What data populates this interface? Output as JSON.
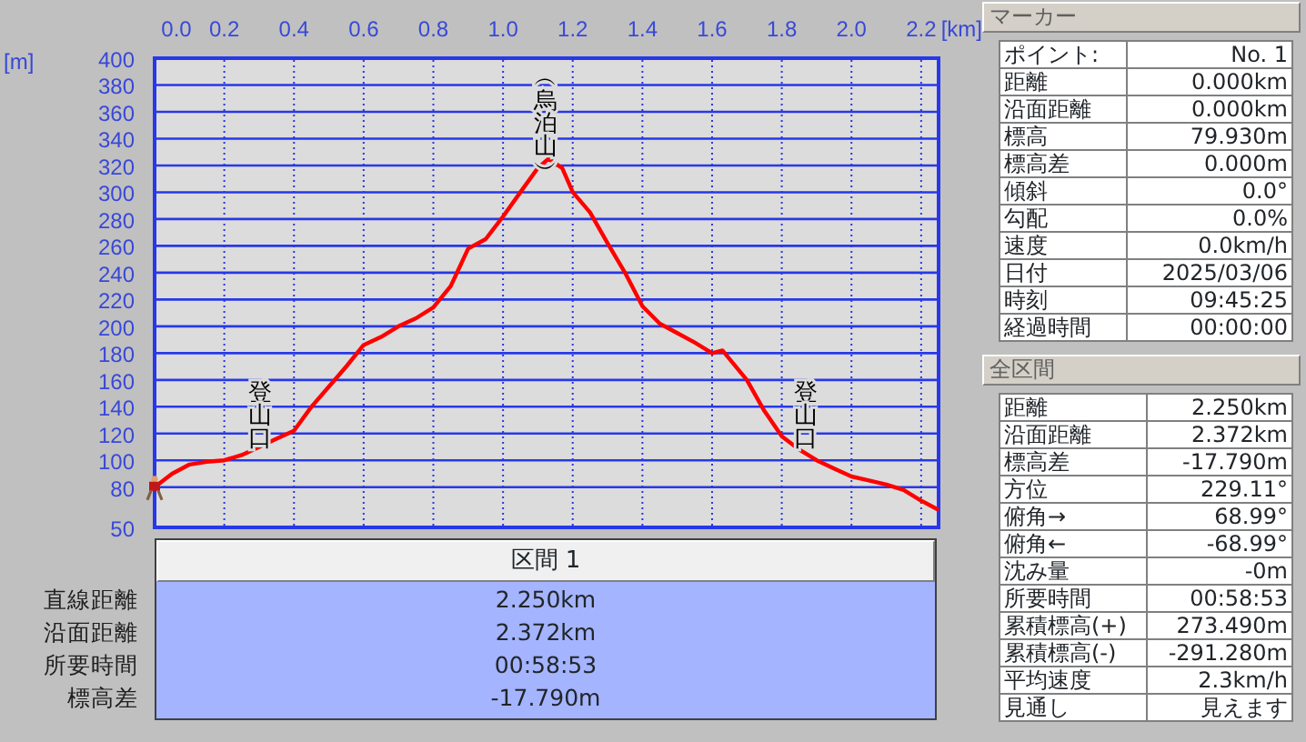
{
  "profile_chart": {
    "chart_data": {
      "type": "line",
      "xlabel": "[km]",
      "ylabel": "[m]",
      "xlim": [
        0,
        2.25
      ],
      "ylim": [
        50,
        400
      ],
      "xticks": [
        {
          "value": 0,
          "label": "0.0"
        },
        {
          "value": 0.2,
          "label": "0.2"
        },
        {
          "value": 0.4,
          "label": "0.4"
        },
        {
          "value": 0.6,
          "label": "0.6"
        },
        {
          "value": 0.8,
          "label": "0.8"
        },
        {
          "value": 1.0,
          "label": "1.0"
        },
        {
          "value": 1.2,
          "label": "1.2"
        },
        {
          "value": 1.4,
          "label": "1.4"
        },
        {
          "value": 1.6,
          "label": "1.6"
        },
        {
          "value": 1.8,
          "label": "1.8"
        },
        {
          "value": 2.0,
          "label": "2.0"
        },
        {
          "value": 2.2,
          "label": "2.2"
        }
      ],
      "yticks": [
        50,
        80,
        100,
        120,
        140,
        160,
        180,
        200,
        220,
        240,
        260,
        280,
        300,
        320,
        340,
        360,
        380,
        400
      ],
      "x": [
        0,
        0.05,
        0.1,
        0.15,
        0.2,
        0.25,
        0.3,
        0.35,
        0.4,
        0.45,
        0.5,
        0.55,
        0.6,
        0.65,
        0.7,
        0.75,
        0.8,
        0.85,
        0.9,
        0.95,
        1.0,
        1.05,
        1.1,
        1.13,
        1.17,
        1.2,
        1.25,
        1.3,
        1.35,
        1.4,
        1.45,
        1.5,
        1.55,
        1.6,
        1.63,
        1.7,
        1.75,
        1.8,
        1.85,
        1.9,
        1.95,
        2.0,
        2.05,
        2.1,
        2.15,
        2.2,
        2.25
      ],
      "grid": true,
      "series": [
        {
          "color": "#ff0000",
          "values": [
            80,
            90,
            97,
            99,
            100,
            104,
            110,
            116,
            122,
            140,
            155,
            170,
            186,
            192,
            200,
            206,
            214,
            230,
            258,
            265,
            282,
            300,
            318,
            325,
            318,
            300,
            285,
            262,
            240,
            215,
            202,
            195,
            188,
            180,
            182,
            160,
            137,
            118,
            108,
            100,
            94,
            88,
            85,
            82,
            78,
            70,
            63
          ]
        }
      ],
      "annotations": [
        "︵烏泊山︶",
        "登山口",
        "登山口"
      ]
    }
  },
  "section_table": {
    "header": "区間 1",
    "rows": [
      {
        "label": "直線距離",
        "value": "2.250km"
      },
      {
        "label": "沿面距離",
        "value": "2.372km"
      },
      {
        "label": "所要時間",
        "value": "00:58:53"
      },
      {
        "label": "標高差",
        "value": "-17.790m"
      }
    ]
  },
  "marker_panel": {
    "title": "マーカー",
    "rows": [
      {
        "label": "ポイント:",
        "value": "No. 1"
      },
      {
        "label": "距離",
        "value": "0.000km"
      },
      {
        "label": "沿面距離",
        "value": "0.000km"
      },
      {
        "label": "標高",
        "value": "79.930m"
      },
      {
        "label": "標高差",
        "value": "0.000m"
      },
      {
        "label": "傾斜",
        "value": "0.0°"
      },
      {
        "label": "勾配",
        "value": "0.0%"
      },
      {
        "label": "速度",
        "value": "0.0km/h"
      },
      {
        "label": "日付",
        "value": "2025/03/06"
      },
      {
        "label": "時刻",
        "value": "09:45:25"
      },
      {
        "label": "経過時間",
        "value": "00:00:00"
      }
    ]
  },
  "total_panel": {
    "title": "全区間",
    "rows": [
      {
        "label": "距離",
        "value": "2.250km"
      },
      {
        "label": "沿面距離",
        "value": "2.372km"
      },
      {
        "label": "標高差",
        "value": "-17.790m"
      },
      {
        "label": "方位",
        "value": "229.11°"
      },
      {
        "label": "俯角→",
        "value": "68.99°"
      },
      {
        "label": "俯角←",
        "value": "-68.99°"
      },
      {
        "label": "沈み量",
        "value": "-0m"
      },
      {
        "label": "所要時間",
        "value": "00:58:53"
      },
      {
        "label": "累積標高(+)",
        "value": "273.490m"
      },
      {
        "label": "累積標高(-)",
        "value": "-291.280m"
      },
      {
        "label": "平均速度",
        "value": "2.3km/h"
      },
      {
        "label": "見通し",
        "value": "見えます"
      }
    ]
  }
}
